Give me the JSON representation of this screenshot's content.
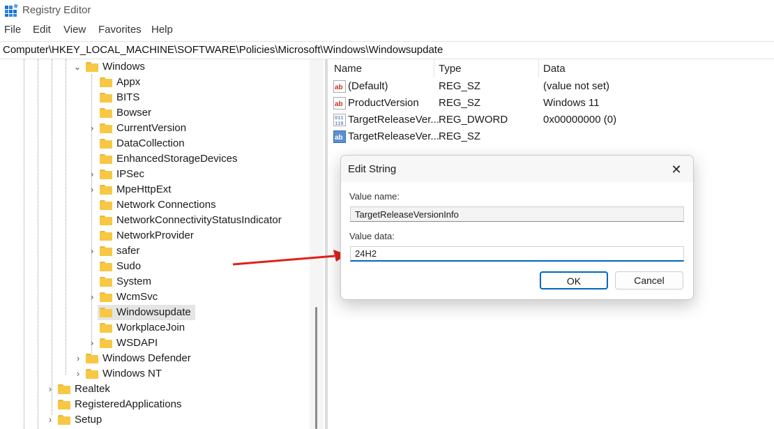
{
  "window": {
    "title": "Registry Editor"
  },
  "menu": [
    "File",
    "Edit",
    "View",
    "Favorites",
    "Help"
  ],
  "address": "Computer\\HKEY_LOCAL_MACHINE\\SOFTWARE\\Policies\\Microsoft\\Windows\\Windowsupdate",
  "tree": {
    "parent": "Windows",
    "children": [
      {
        "label": "Appx",
        "expandable": false
      },
      {
        "label": "BITS",
        "expandable": false
      },
      {
        "label": "Bowser",
        "expandable": false
      },
      {
        "label": "CurrentVersion",
        "expandable": true
      },
      {
        "label": "DataCollection",
        "expandable": false
      },
      {
        "label": "EnhancedStorageDevices",
        "expandable": false
      },
      {
        "label": "IPSec",
        "expandable": true
      },
      {
        "label": "MpeHttpExt",
        "expandable": true
      },
      {
        "label": "Network Connections",
        "expandable": false
      },
      {
        "label": "NetworkConnectivityStatusIndicator",
        "expandable": false
      },
      {
        "label": "NetworkProvider",
        "expandable": false
      },
      {
        "label": "safer",
        "expandable": true
      },
      {
        "label": "Sudo",
        "expandable": false
      },
      {
        "label": "System",
        "expandable": false
      },
      {
        "label": "WcmSvc",
        "expandable": true
      },
      {
        "label": "Windowsupdate",
        "expandable": false,
        "selected": true
      },
      {
        "label": "WorkplaceJoin",
        "expandable": false
      },
      {
        "label": "WSDAPI",
        "expandable": true
      }
    ],
    "siblings": [
      "Windows Defender",
      "Windows NT"
    ],
    "roots": [
      "Realtek",
      "RegisteredApplications",
      "Setup"
    ]
  },
  "list": {
    "columns": {
      "name": "Name",
      "type": "Type",
      "data": "Data"
    },
    "rows": [
      {
        "name": "(Default)",
        "type": "REG_SZ",
        "data": "(value not set)",
        "icon": "string-value-icon"
      },
      {
        "name": "ProductVersion",
        "type": "REG_SZ",
        "data": "Windows 11",
        "icon": "string-value-icon"
      },
      {
        "name": "TargetReleaseVer...",
        "type": "REG_DWORD",
        "data": "0x00000000 (0)",
        "icon": "dword-value-icon"
      },
      {
        "name": "TargetReleaseVer...",
        "type": "REG_SZ",
        "data": "",
        "icon": "string-value-icon-selected"
      }
    ]
  },
  "dialog": {
    "title": "Edit String",
    "value_name_label": "Value name:",
    "value_name": "TargetReleaseVersionInfo",
    "value_data_label": "Value data:",
    "value_data": "24H2",
    "ok_label": "OK",
    "cancel_label": "Cancel",
    "close_glyph": "✕"
  },
  "colors": {
    "accent": "#0067c0",
    "folder": "#f7c843",
    "arrow": "#e0201b",
    "selection": "#e5e5e5"
  }
}
